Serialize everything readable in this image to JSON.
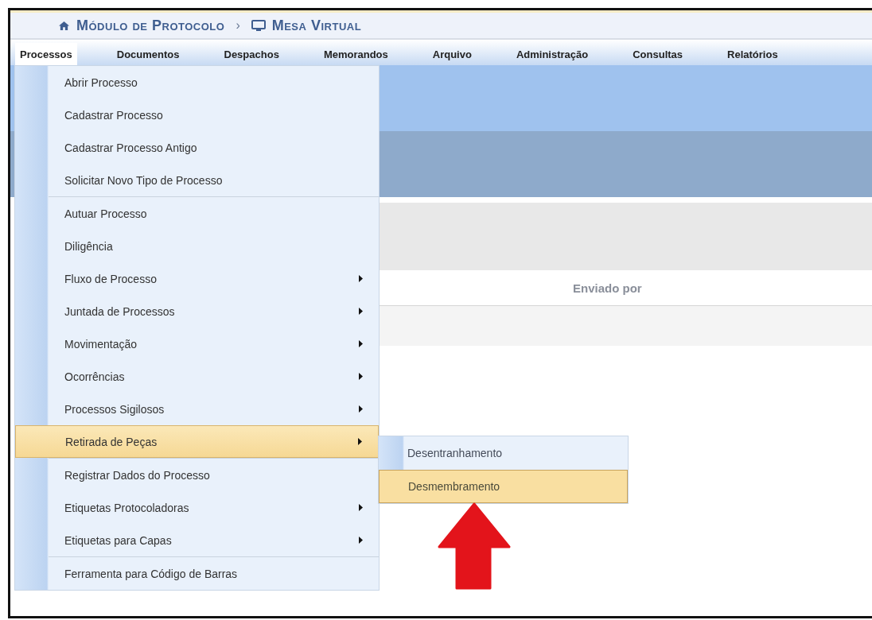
{
  "breadcrumb": {
    "items": [
      {
        "kind": "home",
        "label": "Módulo de Protocolo"
      },
      {
        "kind": "monitor",
        "label": "Mesa Virtual"
      }
    ],
    "separator": "›"
  },
  "menu_bar": [
    {
      "label": "Processos",
      "selected": true
    },
    {
      "label": "Documentos",
      "selected": false
    },
    {
      "label": "Despachos",
      "selected": false
    },
    {
      "label": "Memorandos",
      "selected": false
    },
    {
      "label": "Arquivo",
      "selected": false
    },
    {
      "label": "Administração",
      "selected": false
    },
    {
      "label": "Consultas",
      "selected": false
    },
    {
      "label": "Relatórios",
      "selected": false
    }
  ],
  "dropdown": {
    "groups": [
      [
        {
          "label": "Abrir Processo",
          "has_submenu": false,
          "selected": false
        },
        {
          "label": "Cadastrar Processo",
          "has_submenu": false,
          "selected": false
        },
        {
          "label": "Cadastrar Processo Antigo",
          "has_submenu": false,
          "selected": false
        },
        {
          "label": "Solicitar Novo Tipo de Processo",
          "has_submenu": false,
          "selected": false
        }
      ],
      [
        {
          "label": "Autuar Processo",
          "has_submenu": false,
          "selected": false
        },
        {
          "label": "Diligência",
          "has_submenu": false,
          "selected": false
        },
        {
          "label": "Fluxo de Processo",
          "has_submenu": true,
          "selected": false
        },
        {
          "label": "Juntada de Processos",
          "has_submenu": true,
          "selected": false
        },
        {
          "label": "Movimentação",
          "has_submenu": true,
          "selected": false
        },
        {
          "label": "Ocorrências",
          "has_submenu": true,
          "selected": false
        },
        {
          "label": "Processos Sigilosos",
          "has_submenu": true,
          "selected": false
        },
        {
          "label": "Retirada de Peças",
          "has_submenu": true,
          "selected": true
        }
      ],
      [
        {
          "label": "Registrar Dados do Processo",
          "has_submenu": false,
          "selected": false
        },
        {
          "label": "Etiquetas Protocoladoras",
          "has_submenu": true,
          "selected": false
        },
        {
          "label": "Etiquetas para Capas",
          "has_submenu": true,
          "selected": false
        }
      ],
      [
        {
          "label": "Ferramenta para Código de Barras",
          "has_submenu": false,
          "selected": false
        }
      ]
    ]
  },
  "submenu": [
    {
      "label": "Desentranhamento",
      "selected": false
    },
    {
      "label": "Desmembramento",
      "selected": true
    }
  ],
  "table": {
    "column_header": "Enviado por"
  }
}
